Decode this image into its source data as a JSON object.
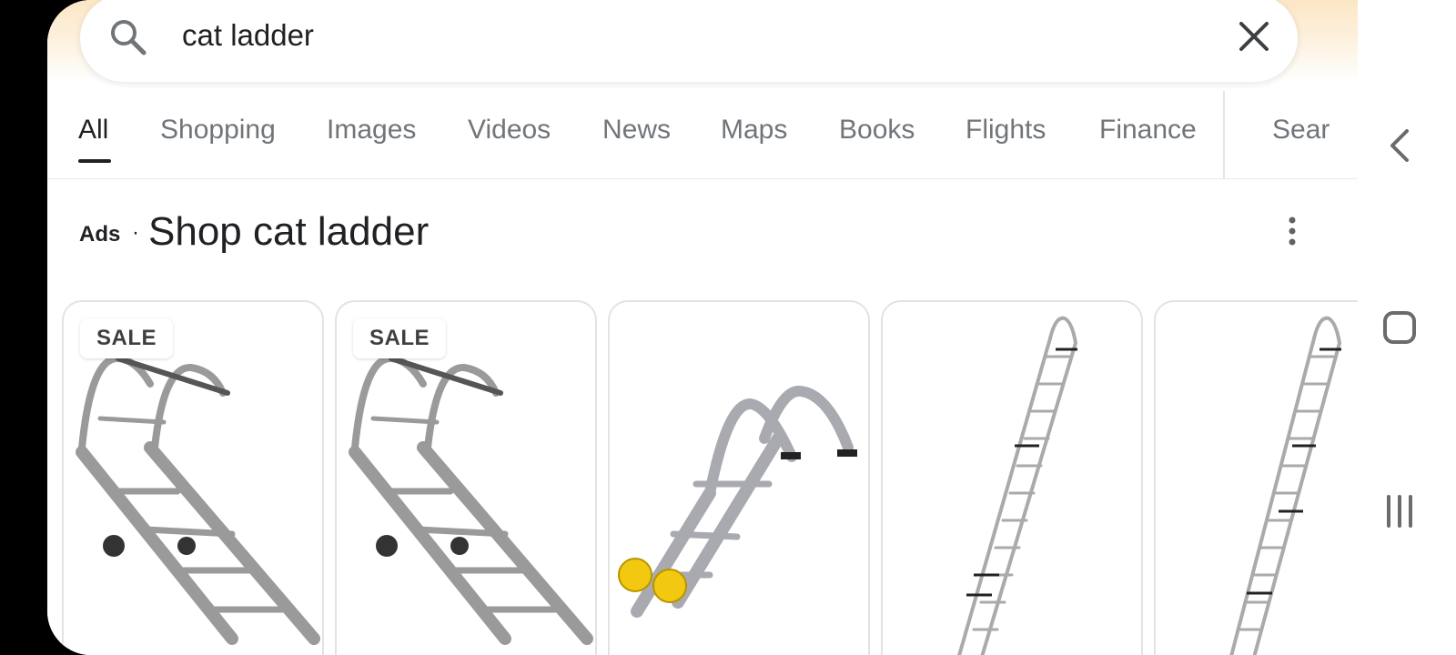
{
  "search": {
    "query": "cat ladder"
  },
  "tabs": [
    {
      "label": "All"
    },
    {
      "label": "Shopping"
    },
    {
      "label": "Images"
    },
    {
      "label": "Videos"
    },
    {
      "label": "News"
    },
    {
      "label": "Maps"
    },
    {
      "label": "Books"
    },
    {
      "label": "Flights"
    },
    {
      "label": "Finance"
    },
    {
      "label": "Sear"
    }
  ],
  "ads": {
    "label": "Ads",
    "separator": "·",
    "title": "Shop cat ladder"
  },
  "products": [
    {
      "badge": "SALE"
    },
    {
      "badge": "SALE"
    },
    {
      "badge": ""
    },
    {
      "badge": ""
    },
    {
      "badge": ""
    }
  ],
  "colors": {
    "accent_underline": "#202124",
    "tab_inactive": "#70757a",
    "header_glow": "#fbe6c4",
    "wheel_yellow": "#f2c811"
  },
  "icons": {
    "search": "search-icon",
    "clear": "close-icon",
    "more": "more-vert-icon",
    "back": "back-icon",
    "home": "home-icon",
    "recents": "recents-icon"
  }
}
